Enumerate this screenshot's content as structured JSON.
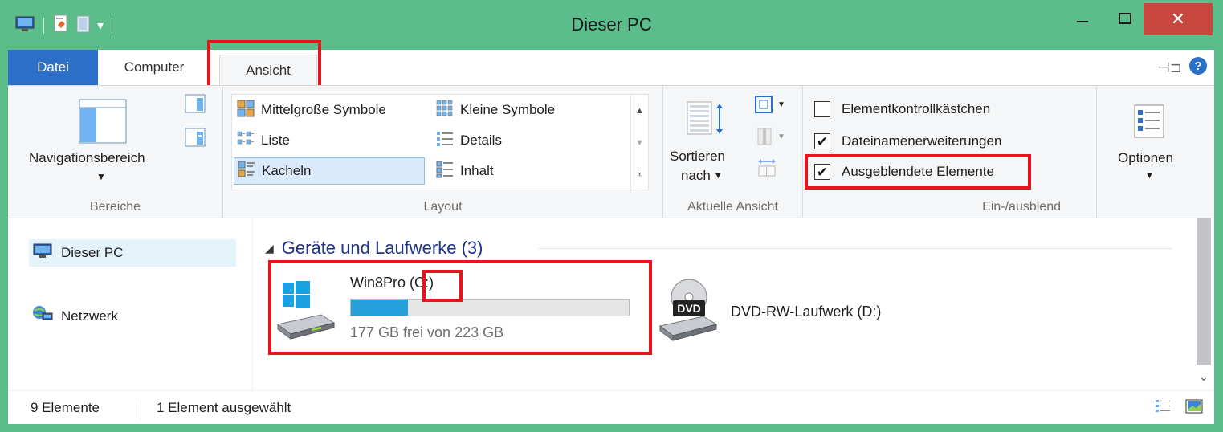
{
  "window": {
    "title": "Dieser PC",
    "min_label": "—",
    "max_label": "☐",
    "close_label": "✕"
  },
  "ribbon": {
    "tabs": [
      {
        "label": "Datei"
      },
      {
        "label": "Computer"
      },
      {
        "label": "Ansicht"
      }
    ],
    "groups": {
      "bereiche": {
        "label": "Bereiche",
        "nav_button": "Navigationsbereich"
      },
      "layout": {
        "label": "Layout",
        "items": [
          {
            "label": "Mittelgroße Symbole"
          },
          {
            "label": "Kleine Symbole"
          },
          {
            "label": "Liste"
          },
          {
            "label": "Details"
          },
          {
            "label": "Kacheln"
          },
          {
            "label": "Inhalt"
          }
        ],
        "selected": "Kacheln"
      },
      "aktuelle_ansicht": {
        "label": "Aktuelle Ansicht",
        "sort_line1": "Sortieren",
        "sort_line2": "nach"
      },
      "ein_ausblenden": {
        "label": "Ein-/ausblend",
        "checkboxes": [
          {
            "label": "Elementkontrollkästchen",
            "checked": false
          },
          {
            "label": "Dateinamenerweiterungen",
            "checked": true
          },
          {
            "label": "Ausgeblendete Elemente",
            "checked": true
          }
        ]
      },
      "optionen": {
        "label": "Optionen"
      }
    }
  },
  "navpane": {
    "items": [
      {
        "label": "Dieser PC",
        "icon": "computer-icon",
        "selected": true
      },
      {
        "label": "Netzwerk",
        "icon": "network-icon",
        "selected": false
      }
    ]
  },
  "main": {
    "group_header": "Geräte und Laufwerke (3)",
    "drives": [
      {
        "name_prefix": "Win8Pro ",
        "name_letter": "(C:)",
        "free_text": "177 GB frei von 223 GB",
        "used_fraction": 0.206,
        "icon": "windows-drive-icon"
      },
      {
        "name": "DVD-RW-Laufwerk (D:)",
        "icon": "dvd-drive-icon",
        "dvd_badge": "DVD"
      }
    ]
  },
  "status": {
    "count": "9 Elemente",
    "selection": "1 Element ausgewählt"
  },
  "colors": {
    "titlebar": "#5bbd8a",
    "close": "#c7463e",
    "file_tab": "#2b6fc8",
    "highlight": "#e8141b",
    "progress": "#26a0da"
  }
}
